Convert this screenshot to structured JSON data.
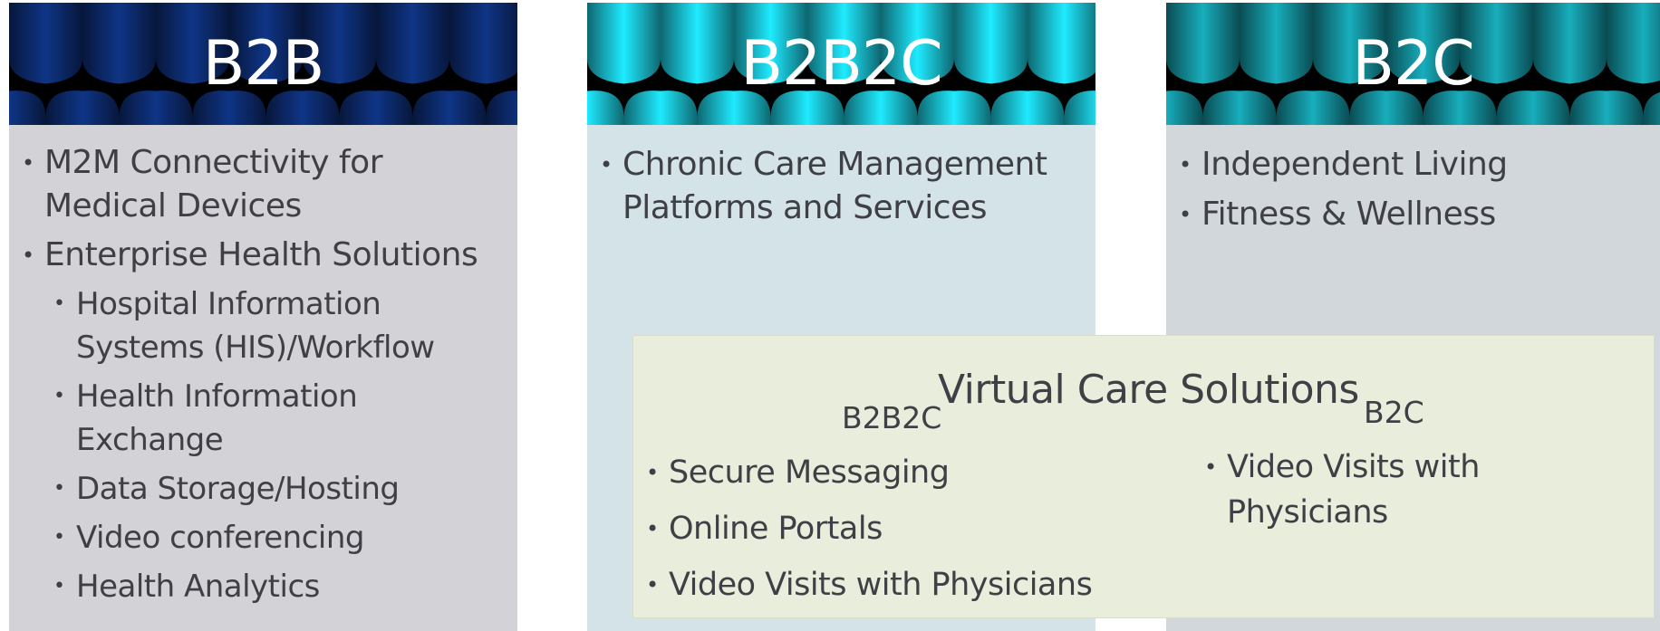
{
  "columns": {
    "b2b": {
      "title": "B2B",
      "header_color": "#0c2a6b",
      "items": [
        {
          "text": "M2M Connectivity for Medical Devices"
        },
        {
          "text": "Enterprise Health Solutions"
        }
      ],
      "subitems": [
        {
          "text": "Hospital Information Systems (HIS)/Workflow"
        },
        {
          "text": "Health Information Exchange"
        },
        {
          "text": "Data Storage/Hosting"
        },
        {
          "text": "Video conferencing"
        },
        {
          "text": "Health Analytics"
        }
      ]
    },
    "b2b2c": {
      "title": "B2B2C",
      "header_color": "#19bccc",
      "items": [
        {
          "text": "Chronic Care Management Platforms and Services"
        }
      ]
    },
    "b2c": {
      "title": "B2C",
      "header_color": "#138b96",
      "items": [
        {
          "text": "Independent Living"
        },
        {
          "text": "Fitness & Wellness"
        }
      ]
    }
  },
  "virtual_care": {
    "title": "Virtual Care Solutions",
    "left_label": "B2B2C",
    "right_label": "B2C",
    "left_items": [
      {
        "text": "Secure Messaging"
      },
      {
        "text": "Online Portals"
      },
      {
        "text": "Video Visits with Physicians"
      }
    ],
    "right_items": [
      {
        "text": "Video Visits with Physicians"
      }
    ]
  },
  "bullet": "•"
}
